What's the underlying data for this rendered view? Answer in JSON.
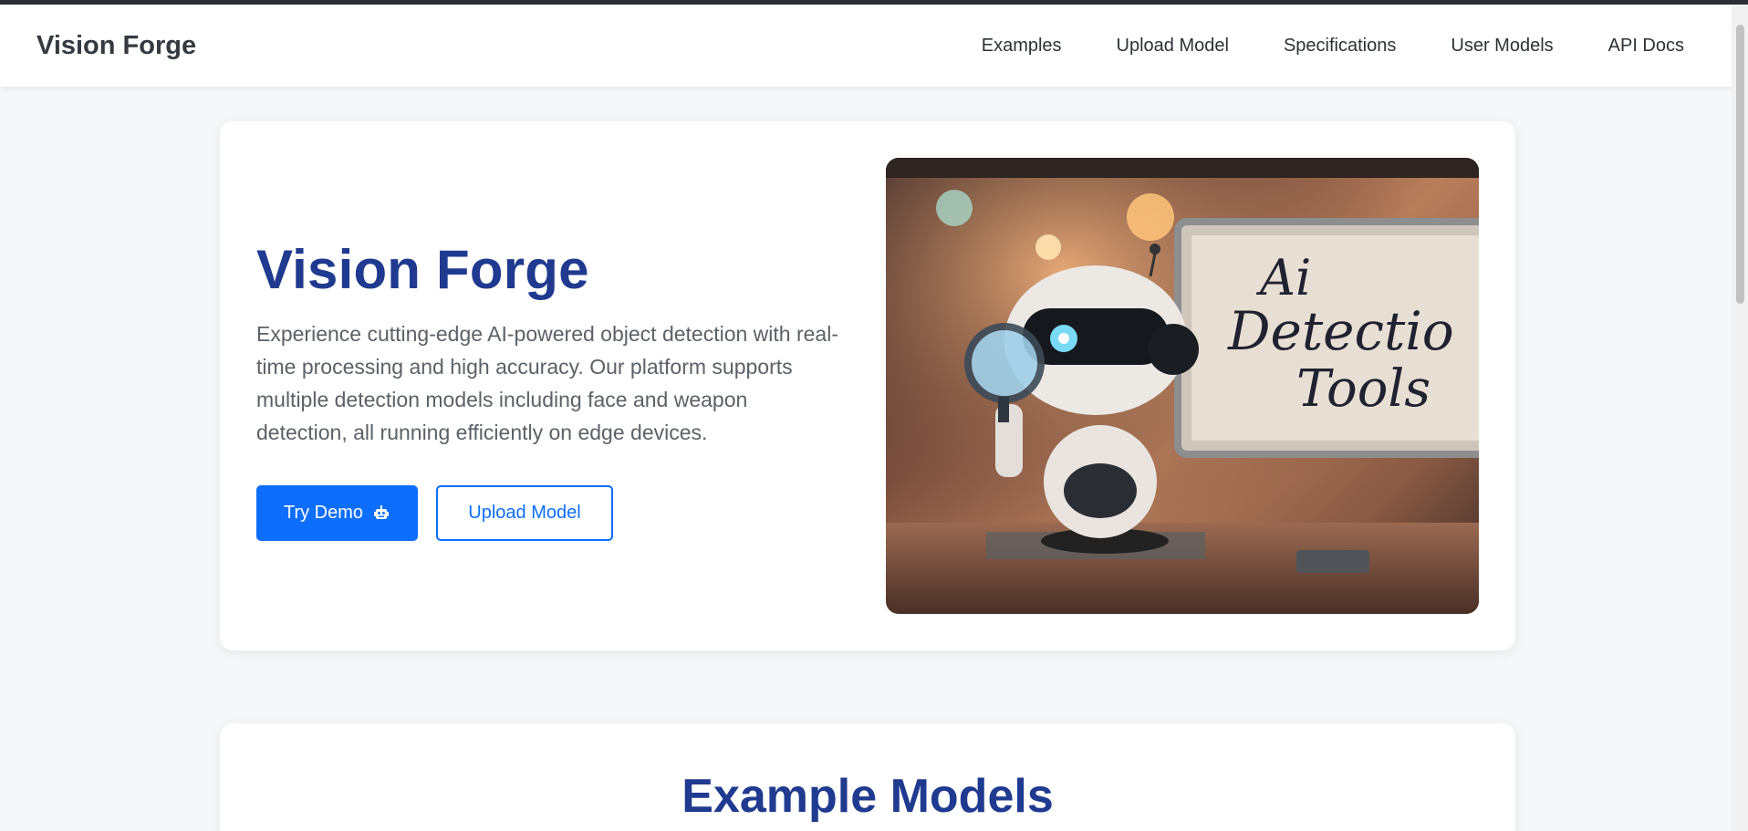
{
  "navbar": {
    "brand": "Vision Forge",
    "links": [
      "Examples",
      "Upload Model",
      "Specifications",
      "User Models",
      "API Docs"
    ]
  },
  "hero": {
    "title": "Vision Forge",
    "description": "Experience cutting-edge AI-powered object detection with real-time processing and high accuracy. Our platform supports multiple detection models including face and weapon detection, all running efficiently on edge devices.",
    "primary_button": "Try Demo",
    "primary_button_icon": "robot-icon",
    "secondary_button": "Upload Model",
    "image": {
      "board_text": [
        "Ai",
        "Detectio",
        "Tools"
      ]
    }
  },
  "models": {
    "title": "Example Models"
  },
  "colors": {
    "accent": "#0d6efd",
    "heading": "#1f3a8f",
    "background": "#f6f7f9"
  }
}
